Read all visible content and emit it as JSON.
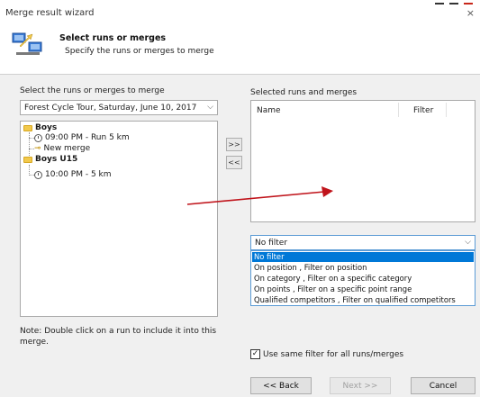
{
  "window": {
    "title": "Merge result wizard",
    "close_glyph": "×"
  },
  "header": {
    "title": "Select runs or merges",
    "subtitle": "Specify the runs or merges to merge",
    "icon": "wizard-icon"
  },
  "left_panel": {
    "label": "Select the runs or merges to merge",
    "event_select": {
      "value": "Forest Cycle Tour, Saturday, June 10, 2017"
    },
    "tree": [
      {
        "label": "Boys",
        "type": "folder"
      },
      {
        "label": "09:00 PM - Run 5 km",
        "type": "run"
      },
      {
        "label": "New merge",
        "type": "merge"
      },
      {
        "label": "Boys U15",
        "type": "folder"
      },
      {
        "label": "10:00 PM - 5 km",
        "type": "run"
      }
    ],
    "note": "Note: Double click on a run to include it into this merge."
  },
  "move_buttons": {
    "add": ">>",
    "remove": "<<"
  },
  "right_panel": {
    "label": "Selected runs and merges",
    "columns": [
      "Name",
      "Filter"
    ],
    "filter_select": {
      "value": "No filter"
    },
    "filter_options": [
      "No filter",
      "On position , Filter on position",
      "On category , Filter on a specific category",
      "On points , Filter on a specific point range",
      "Qualified competitors , Filter on qualified competitors"
    ],
    "selected_option_index": 0,
    "same_filter": {
      "checked": true,
      "label": "Use same filter for all runs/merges"
    }
  },
  "footer": {
    "back": "<< Back",
    "next": "Next >>",
    "cancel": "Cancel"
  },
  "colors": {
    "accent": "#0078d7",
    "annotation_arrow": "#c0141b",
    "folder": "#f2c94c"
  }
}
